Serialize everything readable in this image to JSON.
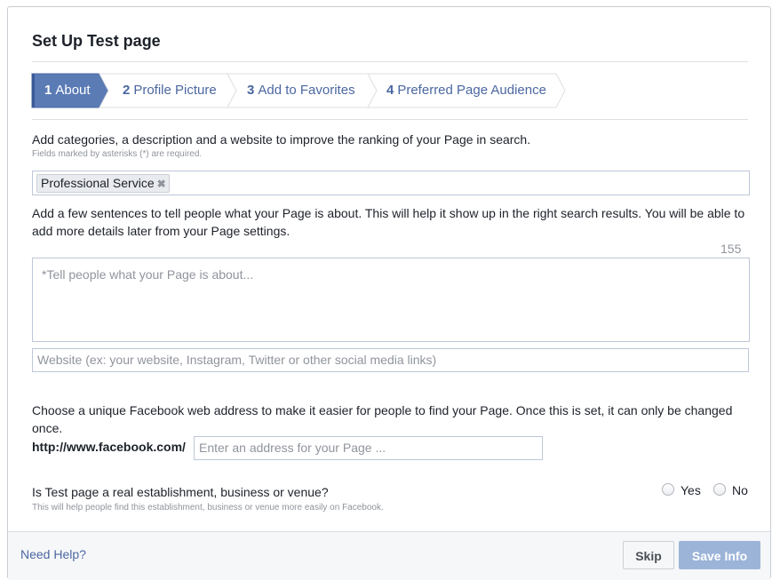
{
  "dialog": {
    "title": "Set Up Test page"
  },
  "steps": [
    {
      "number": "1",
      "label": "About",
      "active": true
    },
    {
      "number": "2",
      "label": "Profile Picture",
      "active": false
    },
    {
      "number": "3",
      "label": "Add to Favorites",
      "active": false
    },
    {
      "number": "4",
      "label": "Preferred Page Audience",
      "active": false
    }
  ],
  "about": {
    "intro": "Add categories, a description and a website to improve the ranking of your Page in search.",
    "required_note": "Fields marked by asterisks (*) are required.",
    "category_token": "Professional Service",
    "token_remove_glyph": "✖",
    "description_help": "Add a few sentences to tell people what your Page is about. This will help it show up in the right search results. You will be able to add more details later from your Page settings.",
    "char_counter": "155",
    "description_placeholder": "*Tell people what your Page is about...",
    "website_placeholder": "Website (ex: your website, Instagram, Twitter or other social media links)"
  },
  "web_address": {
    "help": "Choose a unique Facebook web address to make it easier for people to find your Page. Once this is set, it can only be changed once.",
    "prefix": "http://www.facebook.com/",
    "placeholder": "Enter an address for your Page ..."
  },
  "establishment": {
    "question": "Is Test page a real establishment, business or venue?",
    "note": "This will help people find this establishment, business or venue more easily on Facebook.",
    "yes_label": "Yes",
    "no_label": "No"
  },
  "footer": {
    "help_link": "Need Help?",
    "skip_label": "Skip",
    "save_label": "Save Info"
  },
  "colors": {
    "accent": "#4b67a1",
    "active_step": "#5b7bb5",
    "save_disabled": "#9cb4d8"
  }
}
